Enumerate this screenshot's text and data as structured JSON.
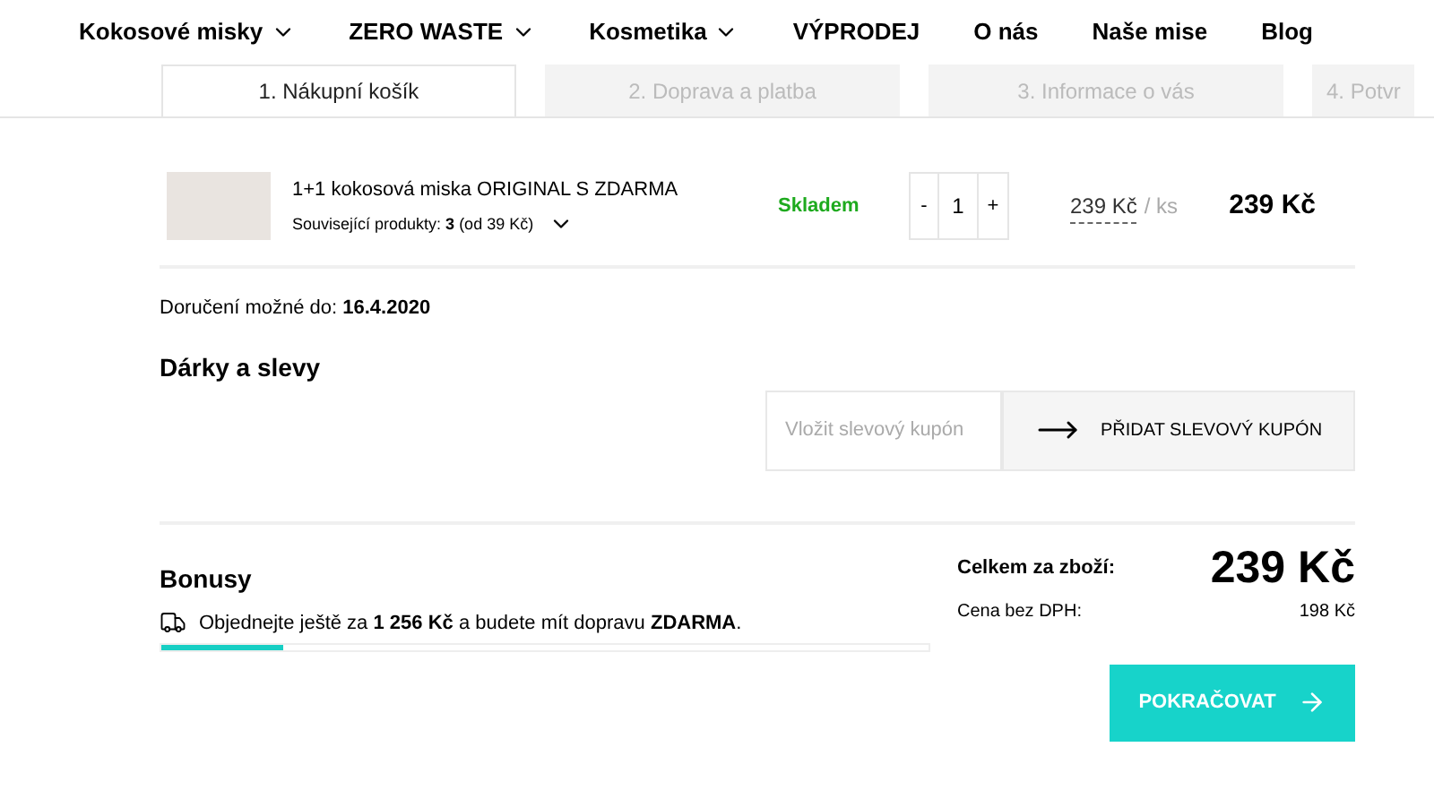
{
  "nav": [
    {
      "label": "Kokosové misky",
      "dropdown": true
    },
    {
      "label": "ZERO WASTE",
      "dropdown": true
    },
    {
      "label": "Kosmetika",
      "dropdown": true
    },
    {
      "label": "VÝPRODEJ",
      "dropdown": false
    },
    {
      "label": "O nás",
      "dropdown": false
    },
    {
      "label": "Naše mise",
      "dropdown": false
    },
    {
      "label": "Blog",
      "dropdown": false
    }
  ],
  "steps": [
    {
      "label": "1. Nákupní košík",
      "selected": true
    },
    {
      "label": "2. Doprava a platba",
      "selected": false
    },
    {
      "label": "3. Informace o vás",
      "selected": false
    },
    {
      "label": "4. Potvr",
      "selected": false
    }
  ],
  "cart_item": {
    "name": "1+1 kokosová miska ORIGINAL S ZDARMA",
    "related": "Související produkty: **3** (od 39 Kč)",
    "stock": "Skladem",
    "minus": "-",
    "quantity": "1",
    "plus": "+",
    "unit_price": "239 Kč",
    "unit": "/ ks",
    "total": "239 Kč"
  },
  "delivery": "Doručení možné do: **16.4.2020**",
  "discounts": {
    "title": "Dárky a slevy",
    "coupon_placeholder": "Vložit slevový kupón",
    "add_button": "PŘIDAT SLEVOVÝ KUPÓN"
  },
  "bonuses": {
    "title": "Bonusy",
    "message": "Objednejte ještě za **1 256 Kč** a budete mít dopravu **ZDARMA**.",
    "level": 0.16
  },
  "summary": {
    "total_label": "Celkem za zboží:",
    "total": "239 Kč",
    "net_label": "Cena bez DPH:",
    "net": "198 Kč"
  },
  "continue_button": "POKRAČOVAT"
}
